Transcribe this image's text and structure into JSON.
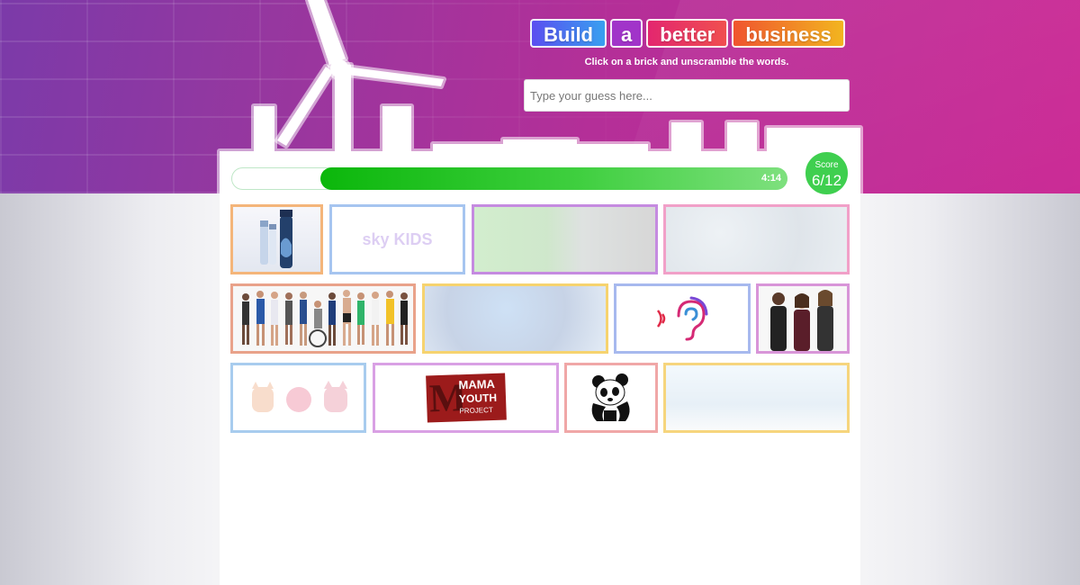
{
  "title": {
    "words": [
      "Build",
      "a",
      "better",
      "business"
    ]
  },
  "instruction": "Click on a brick and unscramble the words.",
  "guess": {
    "placeholder": "Type your guess here...",
    "value": ""
  },
  "timer": {
    "text": "4:14",
    "progress": 0.84
  },
  "score": {
    "label": "Score",
    "value": "6/12"
  },
  "bricks": [
    {
      "icon": "water-bottles-image",
      "state": "solved"
    },
    {
      "icon": "sky-kids-logo",
      "state": "hidden",
      "logo_text": "sky KIDS"
    },
    {
      "icon": "film-set-people-image",
      "state": "hidden"
    },
    {
      "icon": "ice-texture-image",
      "state": "hidden"
    },
    {
      "icon": "athletes-group-image",
      "state": "solved"
    },
    {
      "icon": "blue-character-image",
      "state": "hidden"
    },
    {
      "icon": "hearing-ear-icon",
      "state": "solved"
    },
    {
      "icon": "three-women-image",
      "state": "solved"
    },
    {
      "icon": "owl-faces-icon",
      "state": "hidden"
    },
    {
      "icon": "mama-youth-project-logo",
      "state": "solved",
      "logo_text": [
        "MAMA",
        "YOUTH",
        "PROJECT"
      ]
    },
    {
      "icon": "wwf-panda-logo",
      "state": "solved"
    },
    {
      "icon": "wind-turbine-building-image",
      "state": "hidden"
    }
  ],
  "colors": {
    "accent_purple": "#96379f",
    "accent_pink": "#cb2a95",
    "timer_green": "#0bb70b",
    "score_green": "#3fcf4f"
  }
}
